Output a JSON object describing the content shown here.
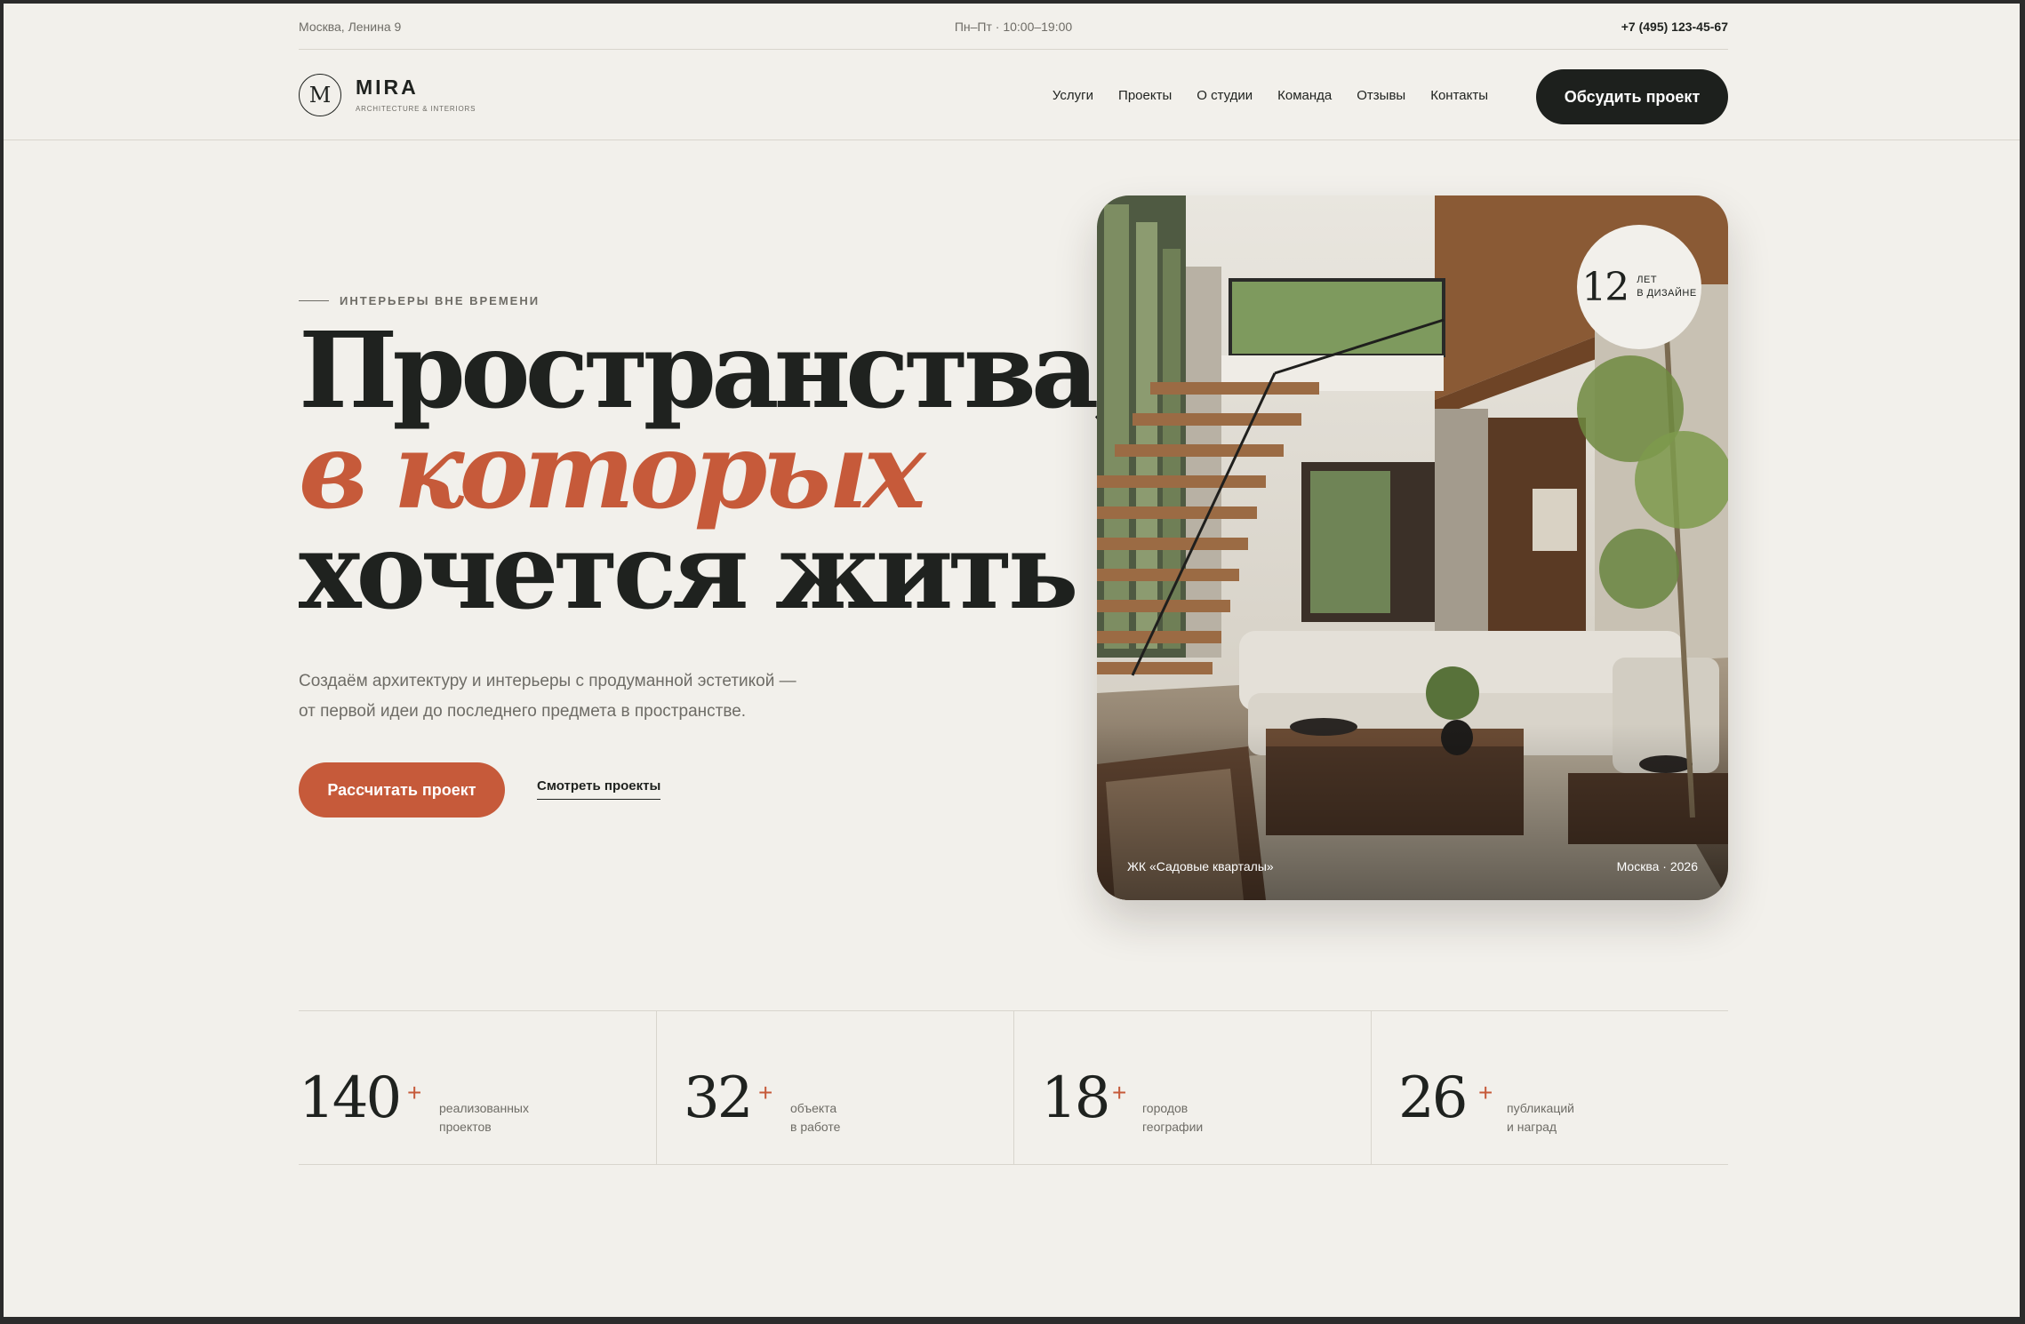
{
  "topbar": {
    "address": "Москва, Ленина 9",
    "hours": "Пн–Пт · 10:00–19:00",
    "phone": "+7 (495) 123-45-67"
  },
  "brand": {
    "monogram": "M",
    "name": "MIRA",
    "tagline": "ARCHITECTURE & INTERIORS"
  },
  "nav": {
    "items": [
      {
        "label": "Услуги"
      },
      {
        "label": "Проекты"
      },
      {
        "label": "О студии"
      },
      {
        "label": "Команда"
      },
      {
        "label": "Отзывы"
      },
      {
        "label": "Контакты"
      }
    ],
    "cta": "Обсудить проект"
  },
  "hero": {
    "eyebrow": "ИНТЕРЬЕРЫ ВНЕ ВРЕМЕНИ",
    "headline": [
      "Пространства,",
      "в которых",
      "хочется жить"
    ],
    "lede": [
      "Создаём архитектуру и интерьеры с продуманной эстетикой —",
      "от первой идеи до последнего предмета в пространстве."
    ],
    "primary_cta": "Рассчитать проект",
    "secondary_cta": "Смотреть проекты",
    "accent_color": "#c65a3a"
  },
  "card": {
    "badge_number": "12",
    "badge_label": [
      "ЛЕТ",
      "В ДИЗАЙНЕ"
    ],
    "caption_left": "ЖК «Садовые кварталы»",
    "caption_right": "Москва · 2026"
  },
  "stats": [
    {
      "value": "140",
      "plus": "+",
      "label": [
        "реализованных",
        "проектов"
      ]
    },
    {
      "value": "32",
      "plus": "+",
      "label": [
        "объекта",
        "в работе"
      ]
    },
    {
      "value": "18",
      "plus": "+",
      "label": [
        "городов",
        "географии"
      ]
    },
    {
      "value": "26",
      "plus": "+",
      "label": [
        "публикаций",
        "и наград"
      ]
    }
  ]
}
